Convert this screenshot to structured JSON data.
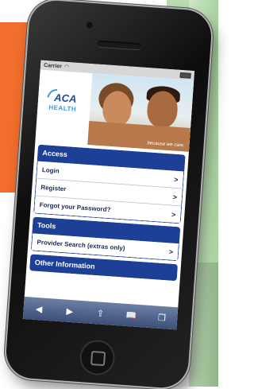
{
  "status_bar": {
    "carrier": "Carrier"
  },
  "banner": {
    "logo_line1": "ACA",
    "logo_line2": "HEALTH",
    "tagline": "because we care."
  },
  "sections": [
    {
      "title": "Access",
      "items": [
        "Login",
        "Register",
        "Forgot your Password?"
      ]
    },
    {
      "title": "Tools",
      "items": [
        "Provider Search (extras only)"
      ]
    },
    {
      "title": "Other Information",
      "items": []
    }
  ],
  "toolbar": {
    "back": "◀",
    "forward": "▶",
    "share": "⇪",
    "bookmarks": "📖",
    "tabs": "❐"
  },
  "colors": {
    "accent_blue": "#1d3f95",
    "background_orange": "#f26e2c",
    "background_green": "#a8d39e"
  },
  "icons": [
    "wifi-icon",
    "battery-icon",
    "chevron-right-icon",
    "back-arrow-icon",
    "forward-arrow-icon",
    "share-icon",
    "bookmarks-icon",
    "tabs-icon"
  ]
}
